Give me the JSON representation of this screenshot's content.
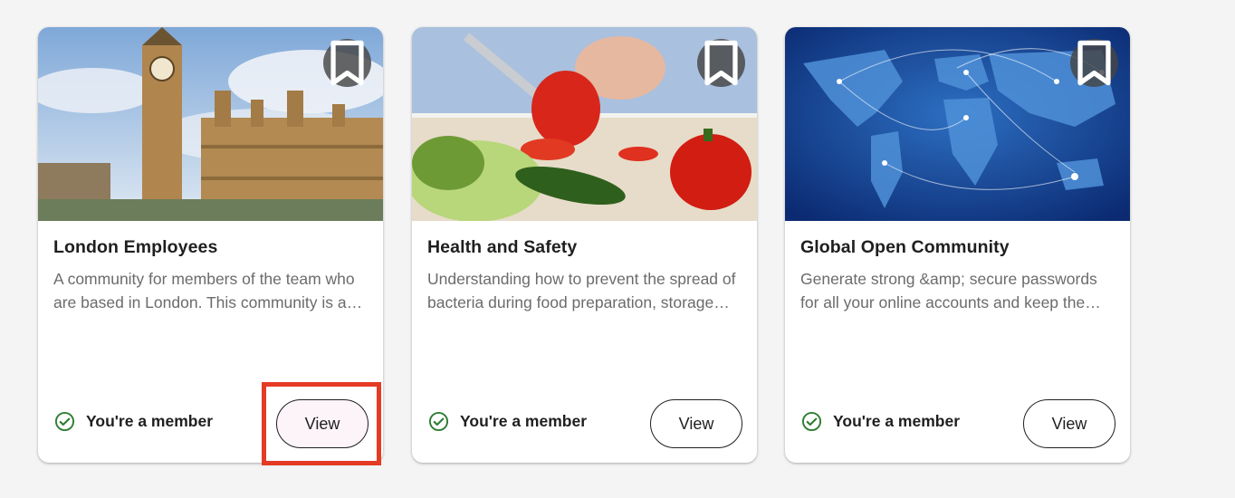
{
  "cards": [
    {
      "title": "London Employees",
      "description": "A community for members of the team who are based in London. This community is a place to share news and updates.",
      "status": "You're a member",
      "view_label": "View",
      "image": "london-big-ben-parliament"
    },
    {
      "title": "Health and Safety",
      "description": "Understanding how to prevent the spread of bacteria during food preparation, storage and serving.",
      "status": "You're a member",
      "view_label": "View",
      "image": "cutting-vegetables"
    },
    {
      "title": "Global Open Community",
      "description": "Generate strong &amp; secure passwords for all your online accounts and keep them safe.",
      "status": "You're a member",
      "view_label": "View",
      "image": "world-map-network"
    }
  ],
  "colors": {
    "member_check": "#2e7d32",
    "highlight": "#e53b25",
    "bookmark_bg": "#464646"
  },
  "icons": {
    "bookmark": "bookmark-icon",
    "status": "check-circle-icon"
  }
}
